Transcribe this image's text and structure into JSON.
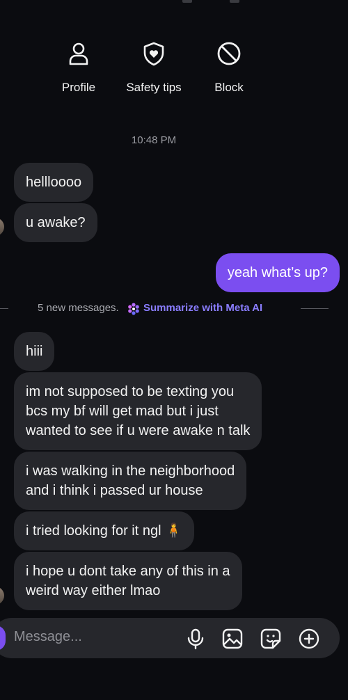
{
  "actions": {
    "profile": {
      "label": "Profile",
      "icon": "person-icon"
    },
    "safety": {
      "label": "Safety tips",
      "icon": "shield-heart-icon"
    },
    "block": {
      "label": "Block",
      "icon": "block-icon"
    }
  },
  "thread": {
    "timestamp": "10:48 PM",
    "messages_before": [
      {
        "text": "hellloooo",
        "from": "them"
      },
      {
        "text": "u awake?",
        "from": "them"
      }
    ],
    "sent": {
      "text": "yeah what’s up?"
    },
    "divider": {
      "new_messages": "5 new messages.",
      "summarize": "Summarize with Meta AI"
    },
    "messages_after": [
      {
        "lines": [
          "hiii"
        ]
      },
      {
        "lines": [
          "im not supposed to be texting you",
          "bcs my bf will get mad but i just",
          "wanted to see if u were awake n talk"
        ]
      },
      {
        "lines": [
          "i was walking in the neighborhood",
          "and i think i passed ur house"
        ]
      },
      {
        "lines": [
          "i tried looking for it ngl 🧍"
        ]
      },
      {
        "lines": [
          "i hope u dont take any of this in a",
          "weird way either lmao"
        ]
      }
    ]
  },
  "composer": {
    "placeholder": "Message...",
    "icons": [
      "microphone-icon",
      "gallery-icon",
      "sticker-icon",
      "add-icon"
    ]
  },
  "colors": {
    "background": "#0b0c10",
    "received_bubble": "#26272c",
    "sent_bubble": "#7b4ef0",
    "meta_ai_link": "#8a7dff"
  }
}
